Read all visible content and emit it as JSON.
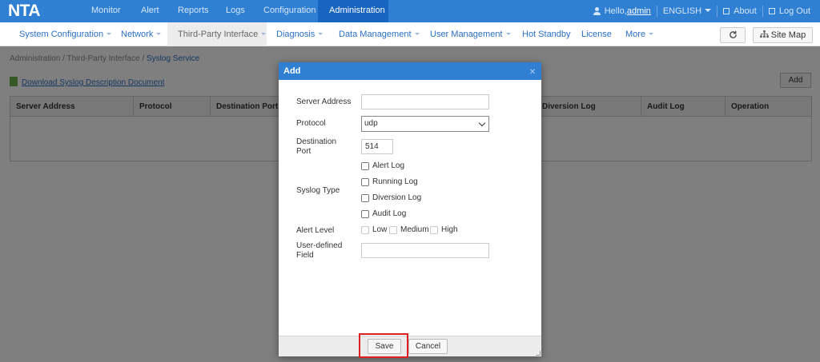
{
  "app": {
    "logo": "NTA"
  },
  "top_nav": [
    "Monitor",
    "Alert",
    "Reports",
    "Logs",
    "Configuration",
    "Administration"
  ],
  "top_right": {
    "hello": "Hello, ",
    "user": "admin",
    "language": "ENGLISH",
    "about": "About",
    "logout": "Log Out"
  },
  "sub_nav": {
    "items": [
      {
        "label": "System Configuration"
      },
      {
        "label": "Network"
      },
      {
        "label": "Third-Party Interface"
      },
      {
        "label": "Diagnosis"
      },
      {
        "label": "Data Management"
      },
      {
        "label": "User Management"
      },
      {
        "label": "Hot Standby"
      },
      {
        "label": "License"
      },
      {
        "label": "More"
      }
    ],
    "site_map": "Site Map"
  },
  "breadcrumb": {
    "parts": [
      "Administration",
      "Third-Party Interface"
    ],
    "current": "Syslog Service"
  },
  "download_link": "Download Syslog Description Document",
  "add_button": "Add",
  "table": {
    "headers": [
      "Server Address",
      "Protocol",
      "Destination Port",
      "Diversion Log",
      "Audit Log",
      "Operation"
    ]
  },
  "dialog": {
    "title": "Add",
    "close": "×",
    "server_address": {
      "label": "Server Address",
      "value": ""
    },
    "protocol": {
      "label": "Protocol",
      "value": "udp"
    },
    "destination_port": {
      "label_1": "Destination",
      "label_2": "Port",
      "value": "514"
    },
    "syslog_type": {
      "label": "Syslog Type",
      "options": [
        {
          "label": "Alert Log",
          "checked": false
        },
        {
          "label": "Running Log",
          "checked": false
        },
        {
          "label": "Diversion Log",
          "checked": false
        },
        {
          "label": "Audit Log",
          "checked": false
        }
      ]
    },
    "alert_level": {
      "label": "Alert Level",
      "options": [
        {
          "label": "Low",
          "checked": false
        },
        {
          "label": "Medium",
          "checked": false
        },
        {
          "label": "High",
          "checked": false
        }
      ]
    },
    "user_defined_field": {
      "label_1": "User-defined",
      "label_2": "Field",
      "value": ""
    },
    "save": "Save",
    "cancel": "Cancel"
  },
  "colors": {
    "brand": "#2f7fd3",
    "active_tab": "#1864c1",
    "highlight": "#e02020"
  }
}
